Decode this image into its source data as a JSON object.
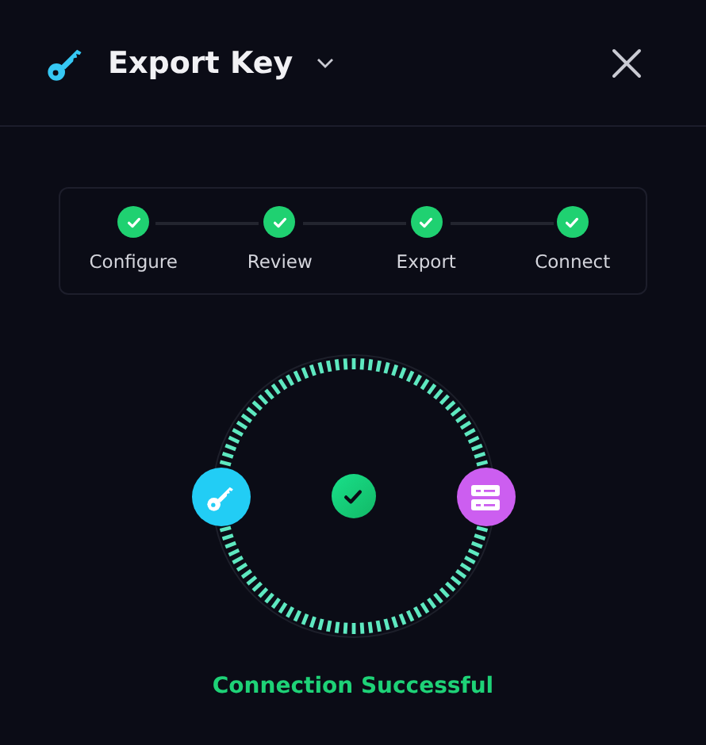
{
  "header": {
    "title": "Export Key"
  },
  "steps": [
    {
      "label": "Configure",
      "done": true
    },
    {
      "label": "Review",
      "done": true
    },
    {
      "label": "Export",
      "done": true
    },
    {
      "label": "Connect",
      "done": true
    }
  ],
  "connection": {
    "connected": true,
    "status": "Connection Successful"
  }
}
